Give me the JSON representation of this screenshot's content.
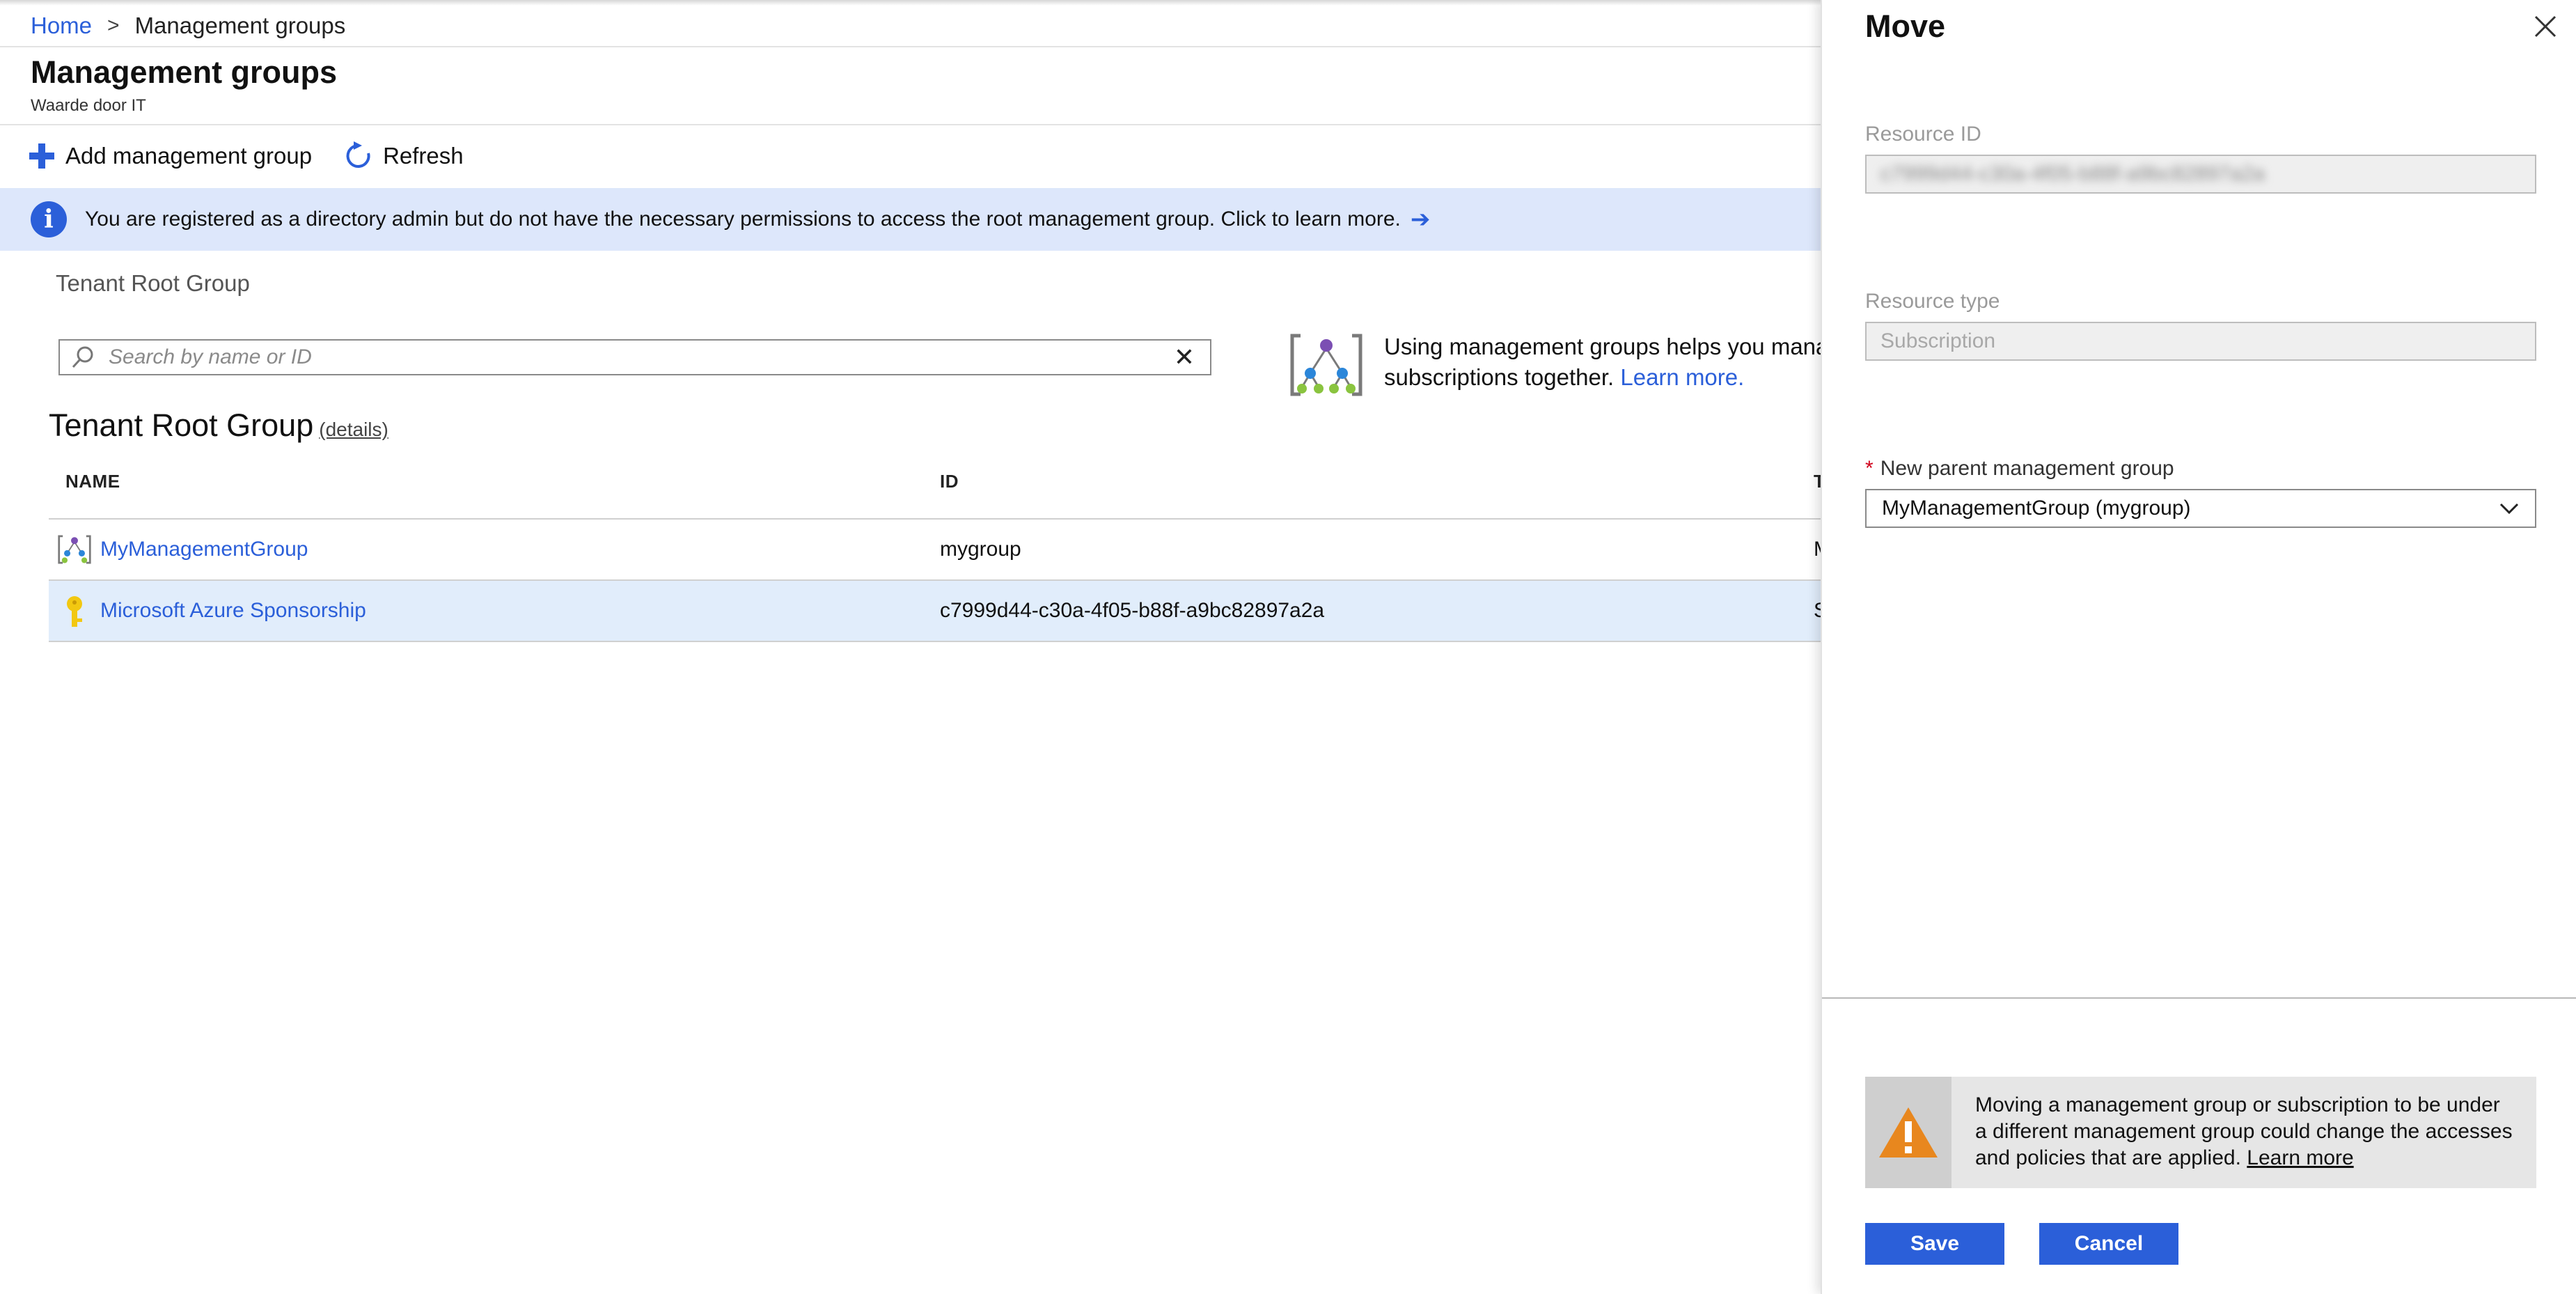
{
  "breadcrumb": {
    "home": "Home",
    "separator": ">",
    "current": "Management groups"
  },
  "page": {
    "title": "Management groups",
    "subtitle": "Waarde door IT"
  },
  "toolbar": {
    "add_label": "Add management group",
    "refresh_label": "Refresh"
  },
  "banner": {
    "text": "You are registered as a directory admin but do not have the necessary permissions to access the root management group. Click to learn more.",
    "arrow": "➔"
  },
  "scope": {
    "label": "Tenant Root Group"
  },
  "search": {
    "placeholder": "Search by name or ID",
    "clear": "✕"
  },
  "promo": {
    "line1": "Using management groups helps you mana",
    "line2": "subscriptions together.",
    "link": "Learn more."
  },
  "section": {
    "title": "Tenant Root Group",
    "details": "(details)"
  },
  "table": {
    "headers": {
      "name": "NAME",
      "id": "ID",
      "type": "T"
    },
    "rows": [
      {
        "name": "MyManagementGroup",
        "id": "mygroup",
        "type": "M",
        "icon": "management-group-icon"
      },
      {
        "name": "Microsoft Azure Sponsorship",
        "id": "c7999d44-c30a-4f05-b88f-a9bc82897a2a",
        "type": "S",
        "icon": "subscription-key-icon"
      }
    ]
  },
  "panel": {
    "title": "Move",
    "resource_id": {
      "label": "Resource ID",
      "value": "c7999d44-c30a-4f05-b88f-a9bc82897a2a"
    },
    "resource_type": {
      "label": "Resource type",
      "value": "Subscription"
    },
    "parent": {
      "required": "*",
      "label": "New parent management group",
      "value": "MyManagementGroup (mygroup)"
    },
    "warning": {
      "line1": "Moving a management group or subscription to be under",
      "line2": "a different management group could change the accesses",
      "line3": "and policies that are applied.",
      "link": "Learn more"
    },
    "save_label": "Save",
    "cancel_label": "Cancel"
  },
  "colors": {
    "accent": "#2b5fd9",
    "banner_bg": "#dde7fb",
    "selected_row": "#e1edfb",
    "warning_orange": "#e8871e",
    "required": "#d0021b"
  }
}
